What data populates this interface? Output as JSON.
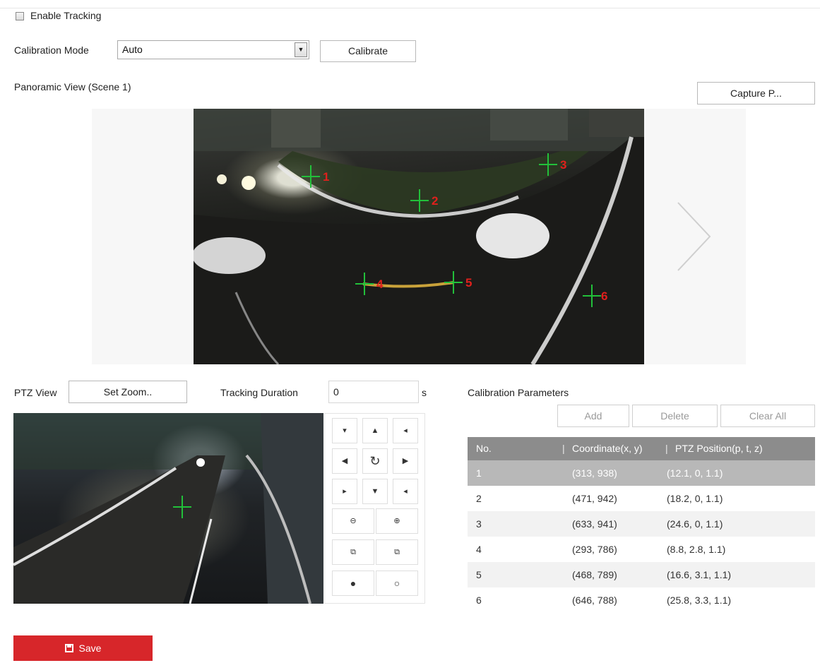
{
  "tracking": {
    "label": "Enable Tracking",
    "checked": false
  },
  "calibration": {
    "mode_label": "Calibration Mode",
    "mode_value": "Auto",
    "calibrate_label": "Calibrate"
  },
  "panorama": {
    "title": "Panoramic View (Scene 1)",
    "capture_label": "Capture P...",
    "markers": [
      "1",
      "2",
      "3",
      "4",
      "5",
      "6"
    ]
  },
  "ptz": {
    "title": "PTZ View",
    "set_zoom_label": "Set Zoom..",
    "duration_label": "Tracking Duration",
    "duration_value": "0",
    "duration_unit": "s"
  },
  "params": {
    "title": "Calibration Parameters",
    "add_label": "Add",
    "delete_label": "Delete",
    "clear_label": "Clear All",
    "columns": [
      "No.",
      "Coordinate(x, y)",
      "PTZ Position(p, t, z)"
    ],
    "rows": [
      [
        "1",
        "(313, 938)",
        "(12.1, 0, 1.1)"
      ],
      [
        "2",
        "(471, 942)",
        "(18.2, 0, 1.1)"
      ],
      [
        "3",
        "(633, 941)",
        "(24.6, 0, 1.1)"
      ],
      [
        "4",
        "(293, 786)",
        "(8.8, 2.8, 1.1)"
      ],
      [
        "5",
        "(468, 789)",
        "(16.6, 3.1, 1.1)"
      ],
      [
        "6",
        "(646, 788)",
        "(25.8, 3.3, 1.1)"
      ]
    ],
    "selected_row": 1
  },
  "save_label": "Save",
  "colors": {
    "accent_red": "#d7262a",
    "marker_green": "#22c03a",
    "marker_red": "#e0201c",
    "table_header": "#8c8c8c"
  }
}
